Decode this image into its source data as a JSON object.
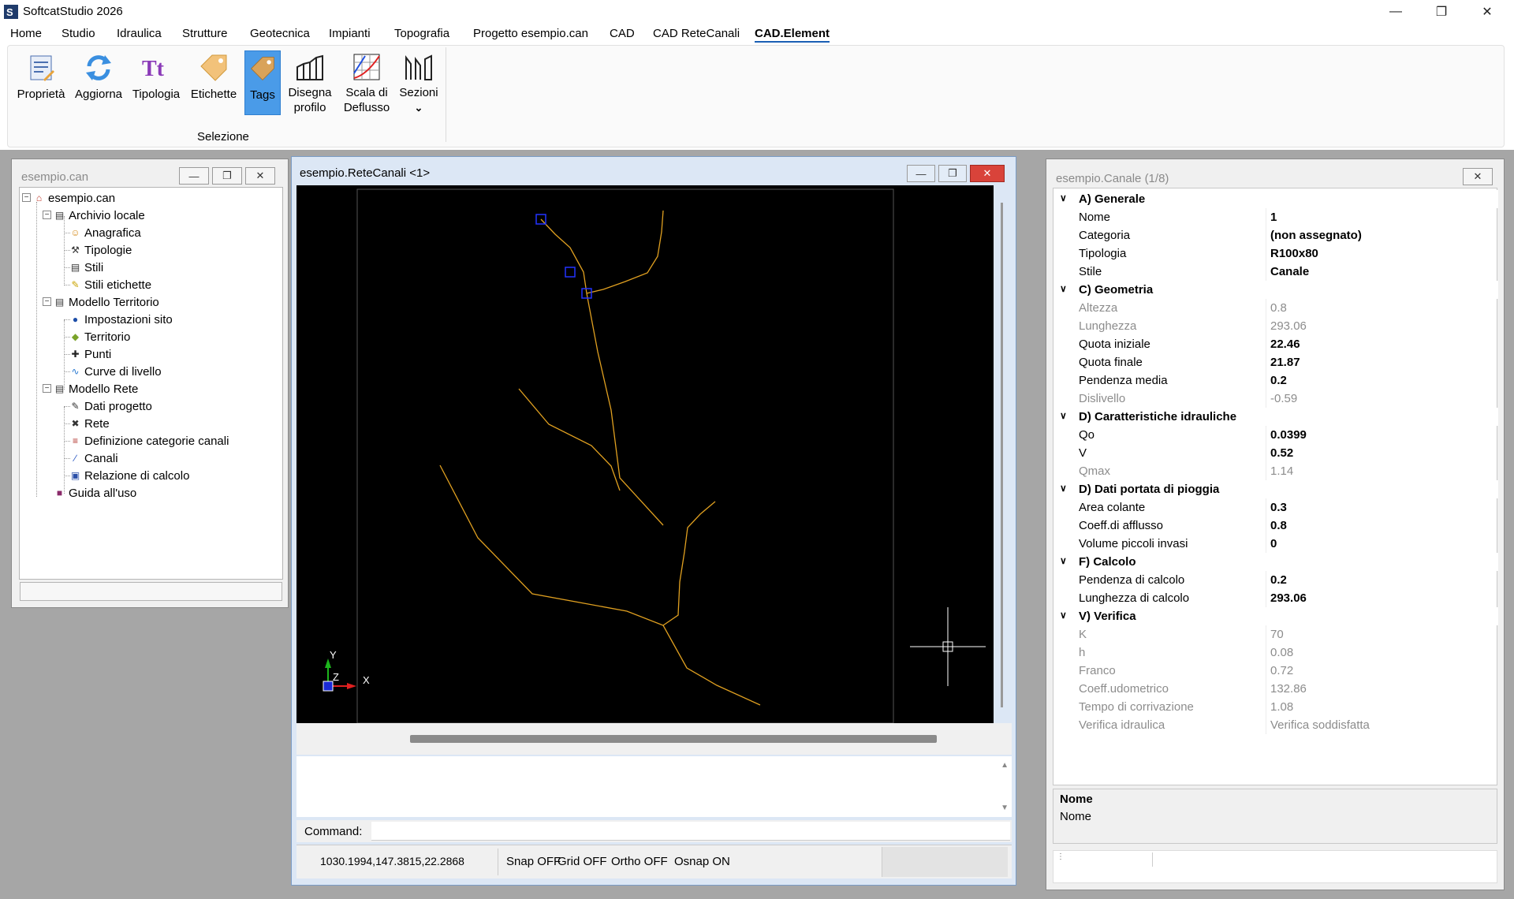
{
  "app": {
    "title": "SoftcatStudio 2026"
  },
  "menu": [
    "Home",
    "Studio",
    "Idraulica",
    "Strutture",
    "Geotecnica",
    "Impianti",
    "Topografia",
    "Progetto esempio.can",
    "CAD",
    "CAD ReteCanali",
    "CAD.Element"
  ],
  "ribbon": {
    "buttons": [
      {
        "label": "Proprietà",
        "icon": "properties-icon"
      },
      {
        "label": "Aggiorna",
        "icon": "refresh-icon"
      },
      {
        "label": "Tipologia",
        "icon": "text-type-icon"
      },
      {
        "label": "Etichette",
        "icon": "label-tag-icon"
      },
      {
        "label": "Tags",
        "icon": "tag-icon"
      },
      {
        "label": "Disegna profilo",
        "icon": "profile-chart-icon"
      },
      {
        "label": "Scala di Deflusso",
        "icon": "flow-scale-icon"
      },
      {
        "label": "Sezioni",
        "icon": "sections-icon"
      }
    ],
    "group_label": "Selezione"
  },
  "left_panel": {
    "title": "esempio.can",
    "tree": [
      {
        "label": "esempio.can",
        "icon": "home-icon",
        "level": 0
      },
      {
        "label": "Archivio locale",
        "icon": "archive-icon",
        "level": 1
      },
      {
        "label": "Anagrafica",
        "icon": "people-icon",
        "level": 2
      },
      {
        "label": "Tipologie",
        "icon": "tools-icon",
        "level": 2
      },
      {
        "label": "Stili",
        "icon": "styles-icon",
        "level": 2
      },
      {
        "label": "Stili etichette",
        "icon": "label-style-icon",
        "level": 2
      },
      {
        "label": "Modello Territorio",
        "icon": "terrain-model-icon",
        "level": 1
      },
      {
        "label": "Impostazioni sito",
        "icon": "globe-icon",
        "level": 2
      },
      {
        "label": "Territorio",
        "icon": "territory-icon",
        "level": 2
      },
      {
        "label": "Punti",
        "icon": "point-icon",
        "level": 2
      },
      {
        "label": "Curve di livello",
        "icon": "contour-icon",
        "level": 2
      },
      {
        "label": "Modello Rete",
        "icon": "network-model-icon",
        "level": 1
      },
      {
        "label": "Dati progetto",
        "icon": "project-data-icon",
        "level": 2
      },
      {
        "label": "Rete",
        "icon": "network-icon",
        "level": 2
      },
      {
        "label": "Definizione categorie canali",
        "icon": "categories-icon",
        "level": 2
      },
      {
        "label": "Canali",
        "icon": "channel-icon",
        "level": 2
      },
      {
        "label": "Relazione di calcolo",
        "icon": "report-icon",
        "level": 2
      },
      {
        "label": "Guida all'uso",
        "icon": "book-icon",
        "level": 1
      }
    ]
  },
  "doc": {
    "title": "esempio.ReteCanali <1>",
    "axis_x": "X",
    "axis_y": "Y",
    "axis_z": "Z",
    "command_label": "Command:",
    "coords": "1030.1994,147.3815,22.2868",
    "snap": "Snap OFF",
    "grid": "Grid OFF",
    "ortho": "Ortho OFF",
    "osnap": "Osnap ON"
  },
  "right_panel": {
    "title": "esempio.Canale (1/8)",
    "rows": [
      {
        "type": "cat",
        "key": "A) Generale"
      },
      {
        "type": "bold",
        "key": "Nome",
        "value": "1"
      },
      {
        "type": "bold",
        "key": "Categoria",
        "value": "(non assegnato)"
      },
      {
        "type": "bold",
        "key": "Tipologia",
        "value": "R100x80"
      },
      {
        "type": "bold",
        "key": "Stile",
        "value": "Canale"
      },
      {
        "type": "cat",
        "key": "C) Geometria"
      },
      {
        "type": "gray",
        "key": "Altezza",
        "value": "0.8"
      },
      {
        "type": "gray",
        "key": "Lunghezza",
        "value": "293.06"
      },
      {
        "type": "bold",
        "key": "Quota iniziale",
        "value": "22.46"
      },
      {
        "type": "bold",
        "key": "Quota finale",
        "value": "21.87"
      },
      {
        "type": "bold",
        "key": "Pendenza media",
        "value": "0.2"
      },
      {
        "type": "gray",
        "key": "Dislivello",
        "value": "-0.59"
      },
      {
        "type": "cat",
        "key": "D) Caratteristiche idrauliche"
      },
      {
        "type": "bold",
        "key": "Qo",
        "value": "0.0399"
      },
      {
        "type": "bold",
        "key": "V",
        "value": "0.52"
      },
      {
        "type": "gray",
        "key": "Qmax",
        "value": "1.14"
      },
      {
        "type": "cat",
        "key": "D) Dati portata di pioggia"
      },
      {
        "type": "bold",
        "key": "Area colante",
        "value": "0.3"
      },
      {
        "type": "bold",
        "key": "Coeff.di afflusso",
        "value": "0.8"
      },
      {
        "type": "bold",
        "key": "Volume piccoli invasi",
        "value": "0"
      },
      {
        "type": "cat",
        "key": "F) Calcolo"
      },
      {
        "type": "bold",
        "key": "Pendenza di calcolo",
        "value": "0.2"
      },
      {
        "type": "bold",
        "key": "Lunghezza di calcolo",
        "value": "293.06"
      },
      {
        "type": "cat",
        "key": "V) Verifica"
      },
      {
        "type": "gray",
        "key": "K",
        "value": "70"
      },
      {
        "type": "gray",
        "key": "h",
        "value": "0.08"
      },
      {
        "type": "gray",
        "key": "Franco",
        "value": "0.72"
      },
      {
        "type": "gray",
        "key": "Coeff.udometrico",
        "value": "132.86"
      },
      {
        "type": "gray",
        "key": "Tempo di corrivazione",
        "value": "1.08"
      },
      {
        "type": "gray",
        "key": "Verifica idraulica",
        "value": "Verifica soddisfatta"
      }
    ],
    "desc_title": "Nome",
    "desc_text": "Nome"
  },
  "colors": {
    "canvas": "#000000",
    "line": "#e0a020",
    "selection": "#1a1aff",
    "ribbon_selected": "#4a9be8"
  }
}
